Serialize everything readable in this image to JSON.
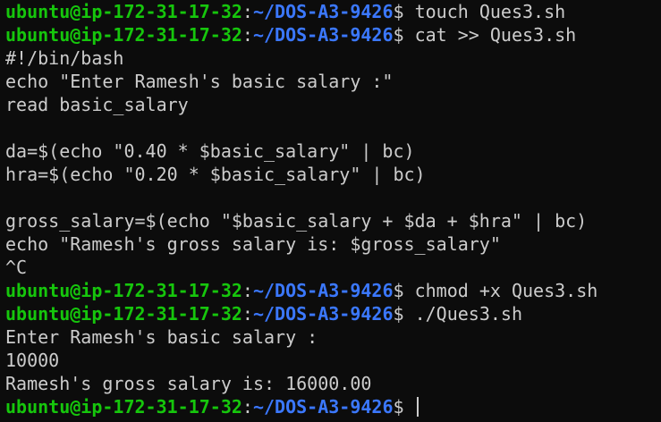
{
  "colors": {
    "background": "#0c0c0c",
    "foreground": "#cccccc",
    "user": "#16c60c",
    "path": "#3b78ff"
  },
  "prompt": {
    "user_host": "ubuntu@ip-172-31-17-32",
    "separator": ":",
    "path": "~/DOS-A3-9426",
    "symbol": "$"
  },
  "lines": [
    {
      "type": "prompt",
      "command": " touch Ques3.sh"
    },
    {
      "type": "prompt",
      "command": " cat >> Ques3.sh"
    },
    {
      "type": "output",
      "text": "#!/bin/bash"
    },
    {
      "type": "output",
      "text": "echo \"Enter Ramesh's basic salary :\""
    },
    {
      "type": "output",
      "text": "read basic_salary"
    },
    {
      "type": "output",
      "text": ""
    },
    {
      "type": "output",
      "text": "da=$(echo \"0.40 * $basic_salary\" | bc)"
    },
    {
      "type": "output",
      "text": "hra=$(echo \"0.20 * $basic_salary\" | bc)"
    },
    {
      "type": "output",
      "text": ""
    },
    {
      "type": "output",
      "text": "gross_salary=$(echo \"$basic_salary + $da + $hra\" | bc)"
    },
    {
      "type": "output",
      "text": "echo \"Ramesh's gross salary is: $gross_salary\""
    },
    {
      "type": "output",
      "text": "^C"
    },
    {
      "type": "prompt",
      "command": " chmod +x Ques3.sh"
    },
    {
      "type": "prompt",
      "command": " ./Ques3.sh"
    },
    {
      "type": "output",
      "text": "Enter Ramesh's basic salary :"
    },
    {
      "type": "output",
      "text": "10000"
    },
    {
      "type": "output",
      "text": "Ramesh's gross salary is: 16000.00"
    },
    {
      "type": "prompt",
      "command": " ",
      "cursor": true
    }
  ]
}
